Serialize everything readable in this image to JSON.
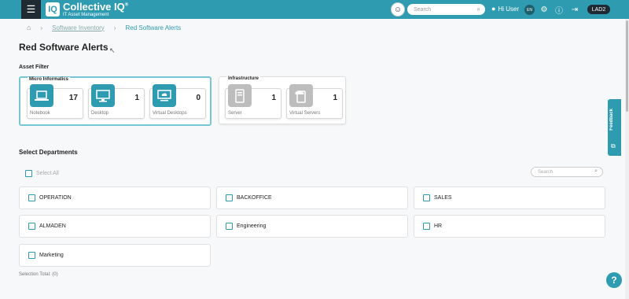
{
  "topbar": {
    "menu_icon": "hamburger-icon",
    "logo_title": "Collective IQ",
    "logo_trademark": "®",
    "logo_subtitle": "IT Asset Management",
    "search_placeholder": "Search",
    "greeting": "Hi User",
    "language": "EN",
    "account_badge": "LAD2",
    "icons": [
      "user-icon",
      "gear-icon",
      "info-icon",
      "logout-icon"
    ],
    "accent_color": "#2f9bb1"
  },
  "breadcrumb": {
    "home_icon": "home-icon",
    "items": [
      "Software Inventory",
      "Red Software Alerts"
    ]
  },
  "page": {
    "title": "Red Software Alerts"
  },
  "asset_filter": {
    "label": "Asset Filter",
    "groups": [
      {
        "label": "Micro Informatics",
        "cards": [
          {
            "name": "Notebook",
            "count": "17",
            "icon": "laptop-icon"
          },
          {
            "name": "Desktop",
            "count": "1",
            "icon": "monitor-icon"
          },
          {
            "name": "Virtual Desktops",
            "count": "0",
            "icon": "cloud-monitor-icon"
          }
        ]
      },
      {
        "label": "Infrastructure",
        "cards": [
          {
            "name": "Server",
            "count": "1",
            "icon": "server-icon"
          },
          {
            "name": "Virtual Servers",
            "count": "1",
            "icon": "virtual-server-icon"
          }
        ]
      }
    ]
  },
  "departments": {
    "label": "Select Departments",
    "select_all": "Select All",
    "search_placeholder": "Search",
    "items": [
      "OPERATION",
      "BACKOFFICE",
      "SALES",
      "ALMADEN",
      "Engineering",
      "HR",
      "Marketing"
    ],
    "selection_total": "Selection Total: (0)"
  },
  "feedback": {
    "label": "Feedback"
  },
  "help": {
    "label": "?"
  }
}
